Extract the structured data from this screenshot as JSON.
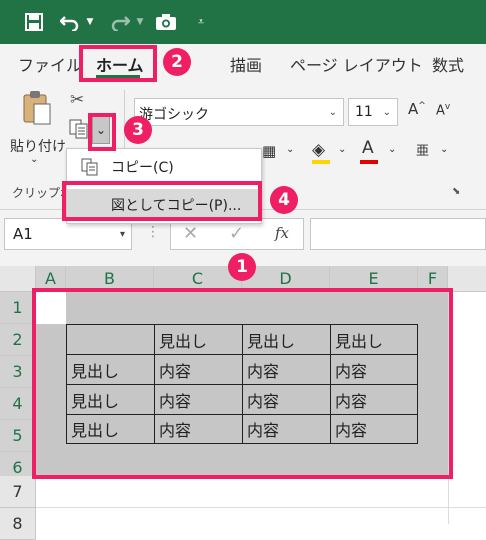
{
  "qat": {
    "icons": [
      "save-icon",
      "undo-icon",
      "redo-icon",
      "camera-icon",
      "customize-icon"
    ]
  },
  "tabs": [
    "ファイル",
    "ホーム",
    "描画",
    "ページ レイアウト",
    "数式"
  ],
  "ribbon": {
    "paste_label": "貼り付け",
    "clipboard_group": "クリップボ",
    "font_name": "游ゴシック",
    "font_size": "11"
  },
  "menu": {
    "copy": "コピー(C)",
    "copy_as_picture": "図としてコピー(P)..."
  },
  "formula_bar": {
    "name_box": "A1",
    "fx": "fx"
  },
  "grid": {
    "columns": [
      "A",
      "B",
      "C",
      "D",
      "E",
      "F"
    ],
    "rows": [
      "1",
      "2",
      "3",
      "4",
      "5",
      "6",
      "7",
      "8"
    ],
    "table": [
      [
        "",
        "見出し",
        "見出し",
        "見出し"
      ],
      [
        "見出し",
        "内容",
        "内容",
        "内容"
      ],
      [
        "見出し",
        "内容",
        "内容",
        "内容"
      ],
      [
        "見出し",
        "内容",
        "内容",
        "内容"
      ]
    ]
  },
  "callouts": [
    "1",
    "2",
    "3",
    "4"
  ],
  "colors": {
    "excel_green": "#217346",
    "highlight": "#ee1f63",
    "selection_fill": "#c6c6c6"
  }
}
